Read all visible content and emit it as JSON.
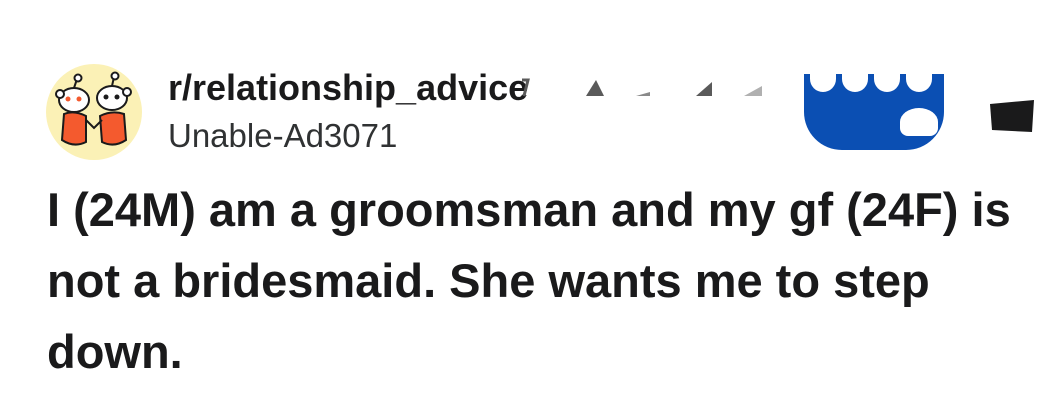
{
  "post": {
    "subreddit": "r/relationship_advice",
    "author": "Unable-Ad3071",
    "title": "I (24M) am a groomsman and my gf (24F) is not a bridesmaid. She wants me to step down."
  },
  "icons": {
    "avatar": "snoo-pair-heart-avatar",
    "join": "join-button-shape",
    "more": "overflow-menu-icon"
  },
  "colors": {
    "join_button": "#0b4fb3",
    "avatar_bg": "#fbf1b6",
    "heart": "#f45a2e",
    "text": "#1a1a1b"
  }
}
